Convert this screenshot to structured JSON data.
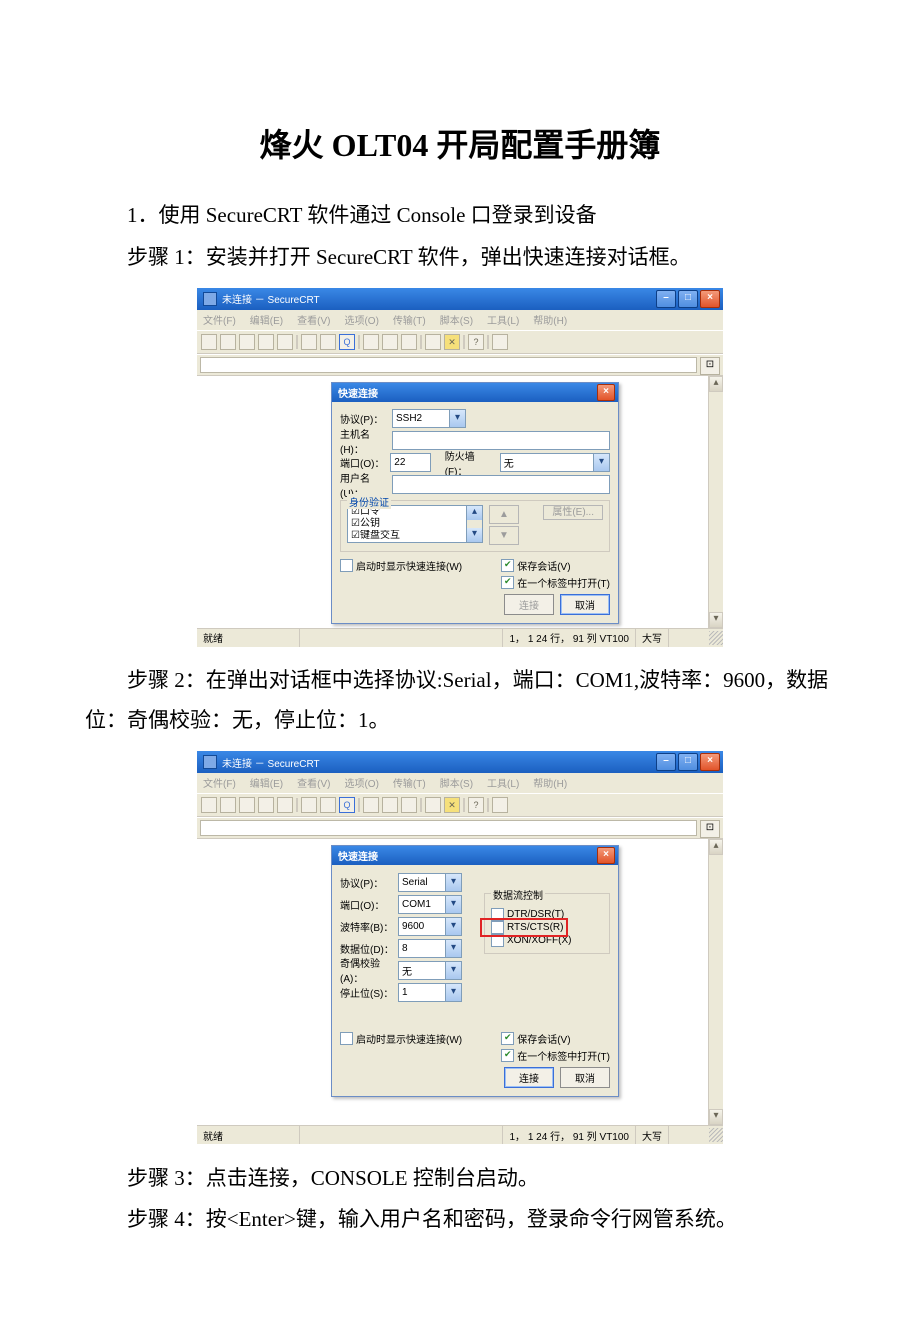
{
  "title": "烽火 OLT04 开局配置手册簿",
  "p1": "1．使用 SecureCRT 软件通过 Console 口登录到设备",
  "p2": "步骤 1：安装并打开 SecureCRT 软件，弹出快速连接对话框。",
  "p3": "步骤 2：在弹出对话框中选择协议:Serial，端口：COM1,波特率：9600，数据位：奇偶校验：无，停止位：1。",
  "p4": "步骤 3：点击连接，CONSOLE 控制台启动。",
  "p5": "步骤 4：按<Enter>键，输入用户名和密码，登录命令行网管系统。",
  "app": {
    "title": "未连接 － SecureCRT",
    "menus": [
      "文件(F)",
      "编辑(E)",
      "查看(V)",
      "选项(O)",
      "传输(T)",
      "脚本(S)",
      "工具(L)",
      "帮助(H)"
    ],
    "status_ready": "就绪",
    "status_pos": "1， 1  24 行， 91 列 VT100",
    "status_caps": "大写"
  },
  "dlg": {
    "title": "快速连接",
    "protocol_lab": "协议(P)：",
    "host_lab": "主机名(H)：",
    "port_lab": "端口(O)：",
    "fw_lab": "防火墙(F)：",
    "user_lab": "用户名(U)：",
    "auth_legend": "身份验证",
    "auth_items": [
      "☑口令",
      "☑公钥",
      "☑键盘交互"
    ],
    "props": "属性(E)...",
    "show_quick": "启动时显示快速连接(W)",
    "save_sess": "保存会话(V)",
    "open_tab": "在一个标签中打开(T)",
    "connect": "连接",
    "cancel": "取消"
  },
  "d1": {
    "protocol": "SSH2",
    "port": "22",
    "fw": "无"
  },
  "d2": {
    "protocol": "Serial",
    "port_lab": "端口(O)：",
    "port": "COM1",
    "baud_lab": "波特率(B)：",
    "baud": "9600",
    "data_lab": "数据位(D)：",
    "data": "8",
    "parity_lab": "奇偶校验(A)：",
    "parity": "无",
    "stop_lab": "停止位(S)：",
    "stop": "1",
    "flow_legend": "数据流控制",
    "flow": [
      "DTR/DSR(T)",
      "RTS/CTS(R)",
      "XON/XOFF(X)"
    ]
  }
}
